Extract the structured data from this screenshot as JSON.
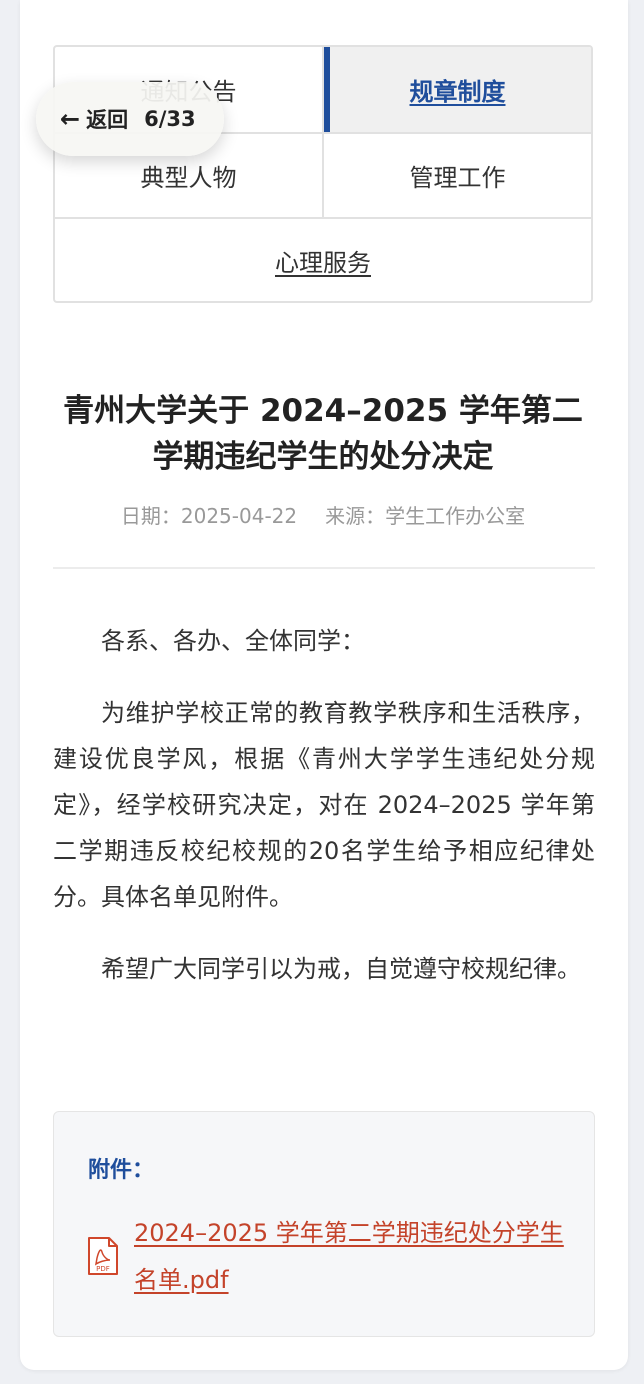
{
  "nav": {
    "items": [
      {
        "label": "通知公告"
      },
      {
        "label": "规章制度"
      },
      {
        "label": "典型人物"
      },
      {
        "label": "管理工作"
      },
      {
        "label": "心理服务"
      }
    ],
    "active_index": 1,
    "accent_color": "#1f4e9c"
  },
  "back": {
    "icon": "arrow-left-icon",
    "label": "返回",
    "counter": "6/33"
  },
  "article": {
    "title": "青州大学关于 2024–2025 学年第二学期违纪学生的处分决定",
    "date": "日期：2025-04-22",
    "source": "来源：学生工作办公室",
    "paragraphs": [
      "各系、各办、全体同学：",
      "为维护学校正常的教育教学秩序和生活秩序，建设优良学风，根据《青州大学学生违纪处分规定》，经学校研究决定，对在 2024–2025 学年第二学期违反校纪校规的20名学生给予相应纪律处分。具体名单见附件。",
      "希望广大同学引以为戒，自觉遵守校规纪律。"
    ]
  },
  "attachment": {
    "label": "附件：",
    "file_icon": "pdf-icon",
    "icon_text": "PDF",
    "file_name": "2024–2025 学年第二学期违纪处分学生名单.pdf",
    "link_color": "#c4432a"
  }
}
